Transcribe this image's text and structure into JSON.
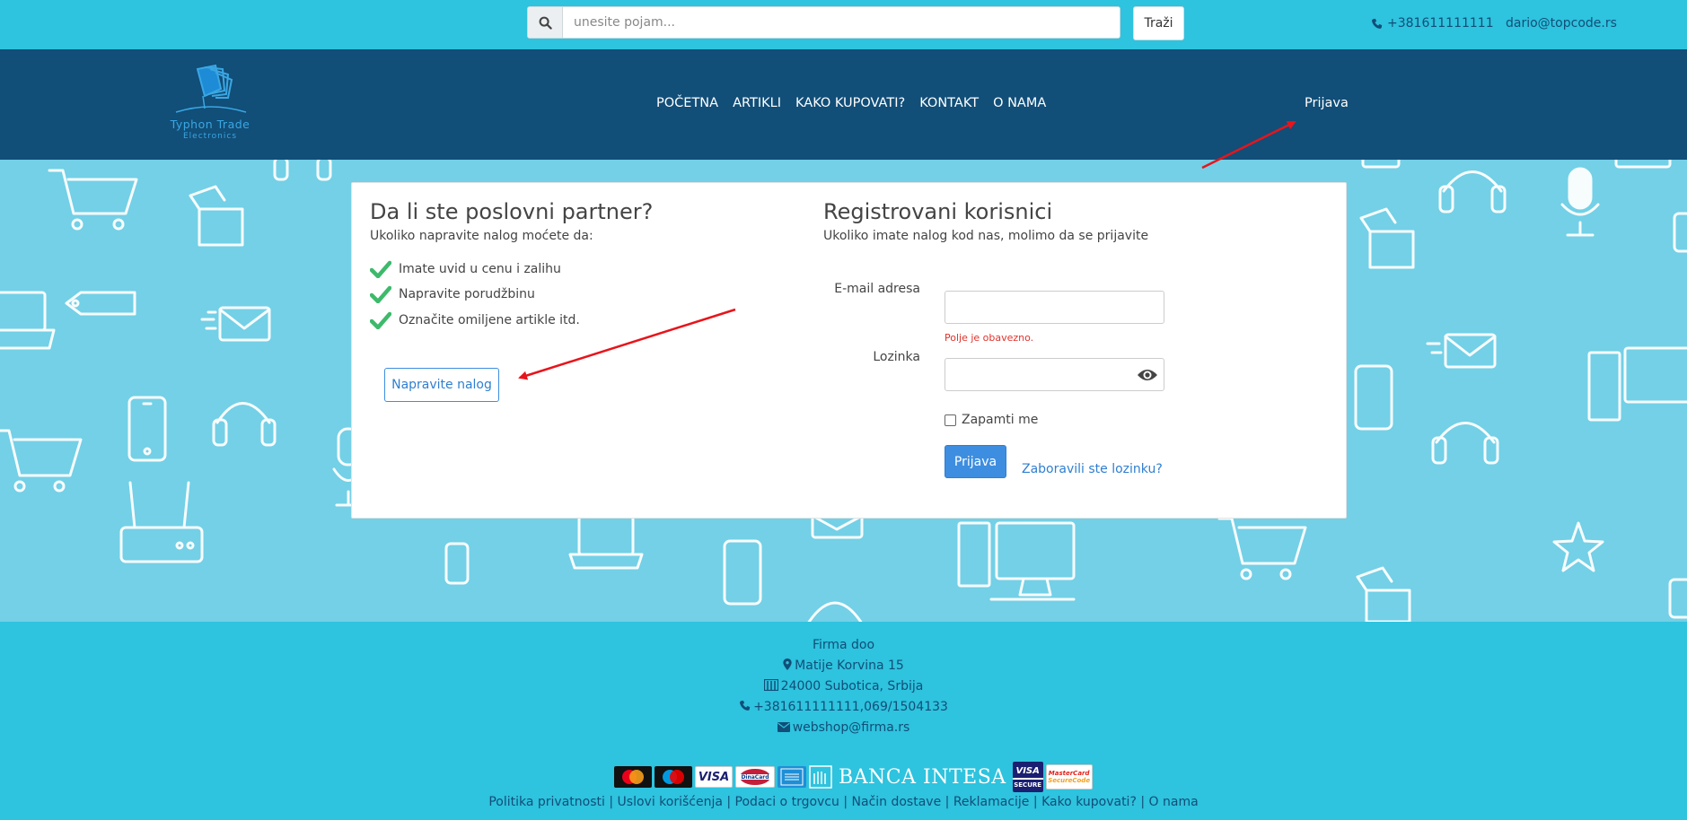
{
  "topbar": {
    "search_placeholder": "unesite pojam...",
    "search_button": "Traži",
    "phone": "+381611111111",
    "email": "dario@topcode.rs"
  },
  "navbar": {
    "logo_line1": "Typhon Trade",
    "logo_line2": "Electronics",
    "items": [
      "POČETNA",
      "ARTIKLI",
      "KAKO KUPOVATI?",
      "KONTAKT",
      "O NAMA"
    ],
    "login": "Prijava"
  },
  "partner": {
    "title": "Da li ste poslovni partner?",
    "subtitle": "Ukoliko napravite nalog moćete da:",
    "benefits": [
      "Imate uvid u cenu i zalihu",
      "Napravite porudžbinu",
      "Označite omiljene artikle itd."
    ],
    "create_account": "Napravite nalog"
  },
  "login": {
    "title": "Registrovani korisnici",
    "subtitle": "Ukoliko imate nalog kod nas, molimo da se prijavite",
    "email_label": "E-mail adresa",
    "email_value": "",
    "email_error": "Polje je obavezno.",
    "password_label": "Lozinka",
    "password_value": "",
    "remember": "Zapamti me",
    "submit": "Prijava",
    "forgot": "Zaboravili ste lozinku?"
  },
  "footer": {
    "company": "Firma doo",
    "street": "Matije Korvina 15",
    "city": "24000 Subotica, Srbija",
    "phones": "+381611111111,069/1504133",
    "email": "webshop@firma.rs",
    "bank": "BANCA INTESA",
    "payment_cards": [
      "mastercard",
      "maestro",
      "VISA",
      "DinaCard",
      "AMERICAN EXPRESS",
      "VISA SECURE",
      "MasterCard SecureCode"
    ],
    "links": [
      "Politika privatnosti",
      "Uslovi korišćenja",
      "Podaci o trgovcu",
      "Način dostave",
      "Reklamacije",
      "Kako kupovati?",
      "O nama"
    ]
  },
  "colors": {
    "topbar": "#2ec3de",
    "navbar": "#114e78",
    "hero": "#73d0e6",
    "primary": "#3d8ee0",
    "check": "#3dba6b",
    "error": "#e0322b",
    "annotation_arrow": "#e8141b"
  }
}
